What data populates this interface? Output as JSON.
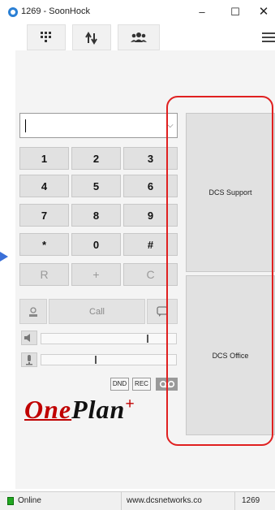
{
  "window": {
    "title": "1269 - SoonHock",
    "minimize": "–",
    "maximize": "☐",
    "close": "✕"
  },
  "tabs": [
    {
      "icon": "dialpad-icon"
    },
    {
      "icon": "transfer-arrows-icon"
    },
    {
      "icon": "contacts-icon"
    }
  ],
  "dialer": {
    "input_value": "",
    "keys": [
      {
        "label": "1"
      },
      {
        "label": "2"
      },
      {
        "label": "3"
      },
      {
        "label": "4"
      },
      {
        "label": "5"
      },
      {
        "label": "6"
      },
      {
        "label": "7"
      },
      {
        "label": "8"
      },
      {
        "label": "9"
      },
      {
        "label": "*"
      },
      {
        "label": "0"
      },
      {
        "label": "#"
      },
      {
        "label": "R"
      },
      {
        "label": "+"
      },
      {
        "label": "C"
      }
    ],
    "call_label": "Call"
  },
  "controls": {
    "dnd_label": "DND",
    "rec_label": "REC",
    "speaker_level": 0.79,
    "mic_level": 0.4
  },
  "logo": {
    "one": "One",
    "plan": "Plan",
    "plus": "+"
  },
  "speed_dial": [
    {
      "label": "DCS Support"
    },
    {
      "label": "DCS Office"
    }
  ],
  "status": {
    "state": "Online",
    "url": "www.dcsnetworks.co",
    "extension": "1269"
  },
  "colors": {
    "accent_red": "#e02020",
    "online_green": "#22a822",
    "arrow_blue": "#3a6fd8"
  }
}
